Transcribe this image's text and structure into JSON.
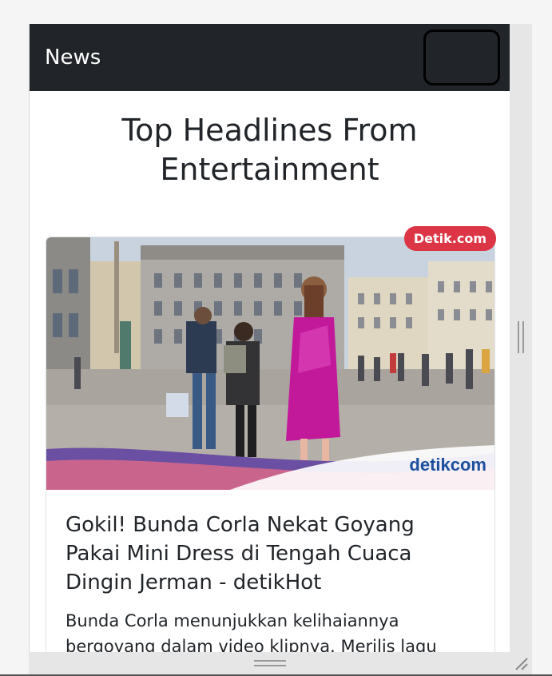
{
  "navbar": {
    "brand": "News",
    "toggler_icon": "hamburger-icon"
  },
  "page": {
    "heading": "Top Headlines From Entertainment"
  },
  "article": {
    "source_badge": "Detik.com",
    "title": "Gokil! Bunda Corla Nekat Goyang Pakai Mini Dress di Tengah Cuaca Dingin Jerman - detikHot",
    "description": "Bunda Corla menunjukkan kelihaiannya bergoyang dalam video klipnya. Merilis lagu",
    "image_watermark": "detikcom"
  },
  "colors": {
    "navbar_bg": "#212529",
    "badge_bg": "#dc3545",
    "dress": "#c2189a"
  }
}
